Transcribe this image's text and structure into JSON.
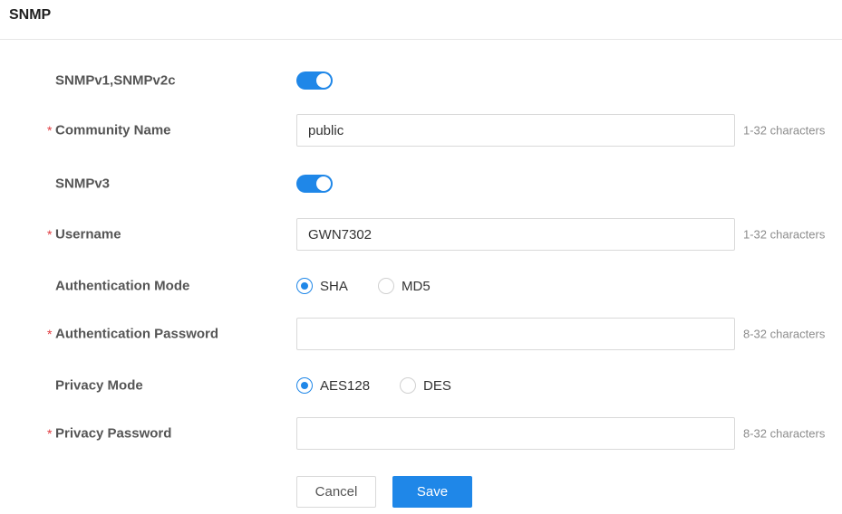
{
  "header": {
    "title": "SNMP"
  },
  "form": {
    "snmpv1v2c": {
      "label": "SNMPv1,SNMPv2c",
      "enabled": true
    },
    "community_name": {
      "required_mark": "*",
      "label": "Community Name",
      "value": "public",
      "hint": "1-32 characters"
    },
    "snmpv3": {
      "label": "SNMPv3",
      "enabled": true
    },
    "username": {
      "required_mark": "*",
      "label": "Username",
      "value": "GWN7302",
      "hint": "1-32 characters"
    },
    "auth_mode": {
      "label": "Authentication Mode",
      "options": [
        "SHA",
        "MD5"
      ],
      "selected": "SHA"
    },
    "auth_password": {
      "required_mark": "*",
      "label": "Authentication Password",
      "value": "",
      "hint": "8-32 characters"
    },
    "privacy_mode": {
      "label": "Privacy Mode",
      "options": [
        "AES128",
        "DES"
      ],
      "selected": "AES128"
    },
    "privacy_password": {
      "required_mark": "*",
      "label": "Privacy Password",
      "value": "",
      "hint": "8-32 characters"
    }
  },
  "actions": {
    "cancel_label": "Cancel",
    "save_label": "Save"
  },
  "colors": {
    "accent": "#1f87e8",
    "required": "#e0393e"
  }
}
